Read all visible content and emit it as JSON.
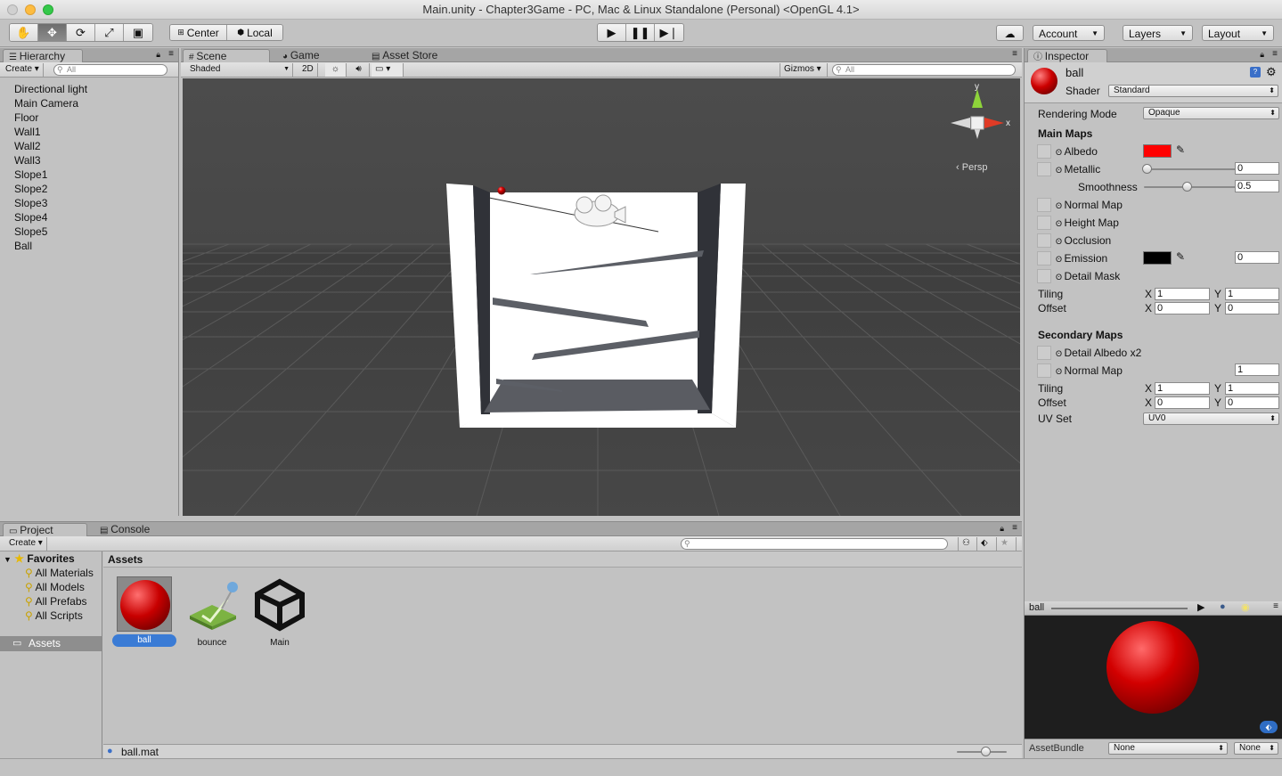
{
  "window": {
    "title": "Main.unity - Chapter3Game - PC, Mac & Linux Standalone (Personal) <OpenGL 4.1>"
  },
  "toolbar": {
    "tools": [
      "hand-icon",
      "move-icon",
      "rotate-icon",
      "scale-icon",
      "rect-icon"
    ],
    "pivot_center": "Center",
    "pivot_local": "Local",
    "play_icons": [
      "play-icon",
      "pause-icon",
      "step-icon"
    ],
    "account": "Account",
    "layers": "Layers",
    "layout": "Layout"
  },
  "hierarchy": {
    "tab": "Hierarchy",
    "create": "Create",
    "search_placeholder": "All",
    "items": [
      "Directional light",
      "Main Camera",
      "Floor",
      "Wall1",
      "Wall2",
      "Wall3",
      "Slope1",
      "Slope2",
      "Slope3",
      "Slope4",
      "Slope5",
      "Ball"
    ]
  },
  "scene": {
    "tabs": [
      "Scene",
      "Game",
      "Asset Store"
    ],
    "shading": "Shaded",
    "mode_2d": "2D",
    "gizmos": "Gizmos",
    "search_placeholder": "All",
    "gizmo_y": "y",
    "gizmo_x": "x",
    "persp": "Persp"
  },
  "inspector": {
    "tab": "Inspector",
    "name": "ball",
    "shader_label": "Shader",
    "shader_value": "Standard",
    "rendering_mode_label": "Rendering Mode",
    "rendering_mode_value": "Opaque",
    "main_maps": "Main Maps",
    "albedo": "Albedo",
    "albedo_color": "#ff0000",
    "metallic": "Metallic",
    "metallic_value": "0",
    "smoothness": "Smoothness",
    "smoothness_value": "0.5",
    "normal_map": "Normal Map",
    "height_map": "Height Map",
    "occlusion": "Occlusion",
    "emission": "Emission",
    "emission_color": "#000000",
    "emission_value": "0",
    "detail_mask": "Detail Mask",
    "tiling": "Tiling",
    "offset": "Offset",
    "x": "X",
    "y": "Y",
    "tiling_x": "1",
    "tiling_y": "1",
    "offset_x": "0",
    "offset_y": "0",
    "secondary_maps": "Secondary Maps",
    "detail_albedo": "Detail Albedo x2",
    "normal_map2": "Normal Map",
    "normal_map2_value": "1",
    "tiling2_x": "1",
    "tiling2_y": "1",
    "offset2_x": "0",
    "offset2_y": "0",
    "uv_set": "UV Set",
    "uv_set_value": "UV0",
    "preview_name": "ball",
    "assetbundle_label": "AssetBundle",
    "assetbundle_value": "None",
    "assetbundle_variant": "None"
  },
  "project": {
    "tabs": [
      "Project",
      "Console"
    ],
    "create": "Create",
    "favorites": "Favorites",
    "favorite_items": [
      "All Materials",
      "All Models",
      "All Prefabs",
      "All Scripts"
    ],
    "assets_folder": "Assets",
    "assets_header": "Assets",
    "assets": [
      {
        "name": "ball",
        "icon": "material-sphere-icon",
        "selected": true
      },
      {
        "name": "bounce",
        "icon": "physics-material-icon",
        "selected": false
      },
      {
        "name": "Main",
        "icon": "unity-scene-icon",
        "selected": false
      }
    ],
    "status_file": "ball.mat"
  }
}
